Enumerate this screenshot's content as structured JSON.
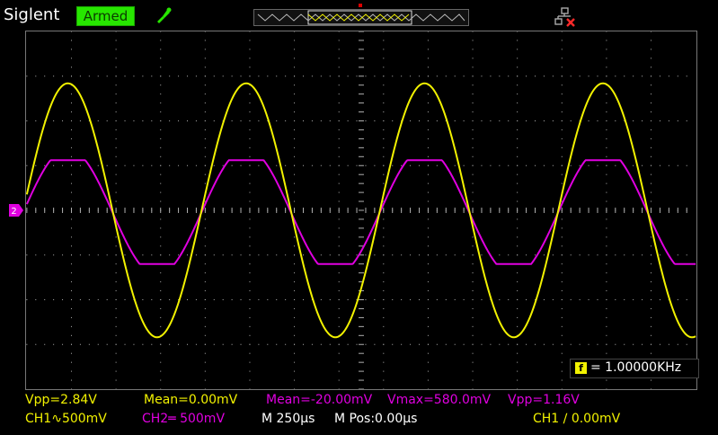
{
  "brand": "Siglent",
  "status": "Armed",
  "frequency": {
    "icon_letter": "f",
    "text": "= 1.00000KHz"
  },
  "markers": {
    "ch2_marker": "2",
    "trigger_marker": "T"
  },
  "measurements_row1": [
    {
      "text": "Vpp=2.84V",
      "channel": "CH1"
    },
    {
      "text": "Mean=0.00mV",
      "channel": "CH1"
    },
    {
      "text": "Mean=-20.00mV",
      "channel": "CH2"
    },
    {
      "text": "Vmax=580.0mV",
      "channel": "CH2"
    },
    {
      "text": "Vpp=1.16V",
      "channel": "CH2"
    }
  ],
  "settings_row2": {
    "ch1": "CH1∿500mV",
    "ch2": "CH2═ 500mV",
    "timebase": "M 250μs",
    "mpos": "M Pos:0.00μs",
    "trigger": "CH1 ∕ 0.00mV"
  },
  "colors": {
    "ch1": "#f2f200",
    "ch2": "#e000e0",
    "grid": "#b0b0b0",
    "armed_bg": "#27e600"
  },
  "icons": [
    "probe-icon",
    "network-disconnected-icon",
    "frequency-icon",
    "trigger-marker-icon",
    "ch2-level-marker-icon"
  ],
  "waveforms": {
    "ch1": {
      "shape": "sine",
      "vpp": 2.84,
      "mean": 0.0,
      "frequency_khz": 1.0
    },
    "ch2": {
      "shape": "clipped-sine",
      "vpp": 1.16,
      "mean": -0.02,
      "vmax": 0.58,
      "frequency_khz": 1.0
    }
  }
}
